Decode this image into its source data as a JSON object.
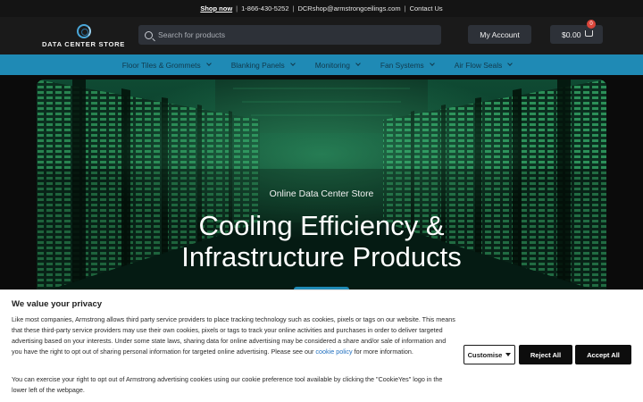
{
  "topbar": {
    "shop_now": "Shop now",
    "phone": "1-866-430-5252",
    "email": "DCRshop@armstrongceilings.com",
    "contact": "Contact Us"
  },
  "header": {
    "logo_text": "DATA CENTER STORE",
    "search_placeholder": "Search for products",
    "account_label": "My Account",
    "cart_total": "$0.00",
    "cart_count": "0"
  },
  "nav": {
    "items": [
      {
        "label": "Floor Tiles & Grommets"
      },
      {
        "label": "Blanking Panels"
      },
      {
        "label": "Monitoring"
      },
      {
        "label": "Fan Systems"
      },
      {
        "label": "Air Flow Seals"
      }
    ]
  },
  "hero": {
    "subtitle": "Online Data Center Store",
    "title_line1": "Cooling Efficiency &",
    "title_line2": "Infrastructure Products"
  },
  "cookie": {
    "heading": "We value your privacy",
    "body1_pre": "Like most companies, Armstrong allows third party service providers to place tracking technology such as cookies, pixels or tags on our website.  This means that these third-party service providers may use their own cookies, pixels or tags to track your online activities and purchases in order to deliver targeted advertising based on your interests.  Under some state laws, sharing data for online advertising may be considered a share and/or sale of information and you have the right to opt out of sharing personal information for targeted online advertising. Please see our ",
    "policy_link": "cookie policy",
    "body1_post": " for more information.",
    "body2": "You can exercise your right to opt out of Armstrong advertising cookies using our cookie preference tool available by clicking the \"CookieYes\" logo in the lower left of the webpage.",
    "customise_label": "Customise",
    "reject_label": "Reject All",
    "accept_label": "Accept All"
  },
  "colors": {
    "nav_bar": "#1f8ab5",
    "hero_green": "#2f9a5c",
    "button_dark": "#0d0d0d"
  }
}
